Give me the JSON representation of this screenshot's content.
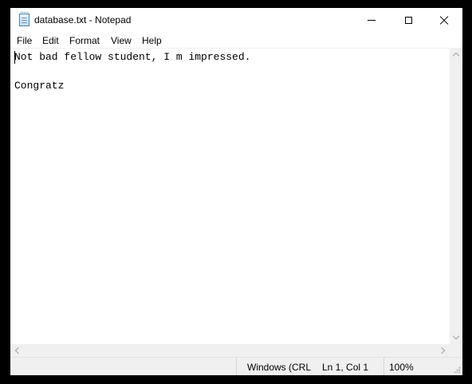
{
  "window": {
    "title": "database.txt - Notepad",
    "app_icon": "notepad-icon",
    "controls": {
      "minimize": "minimize-icon",
      "maximize": "maximize-icon",
      "close": "close-icon"
    }
  },
  "menu": {
    "items": [
      "File",
      "Edit",
      "Format",
      "View",
      "Help"
    ]
  },
  "editor": {
    "lines": [
      "Not bad fellow student, I m impressed.",
      "",
      "Congratz"
    ]
  },
  "status": {
    "encoding": "Windows (CRLF)",
    "position": "Ln 1, Col 1",
    "zoom": "100%"
  }
}
